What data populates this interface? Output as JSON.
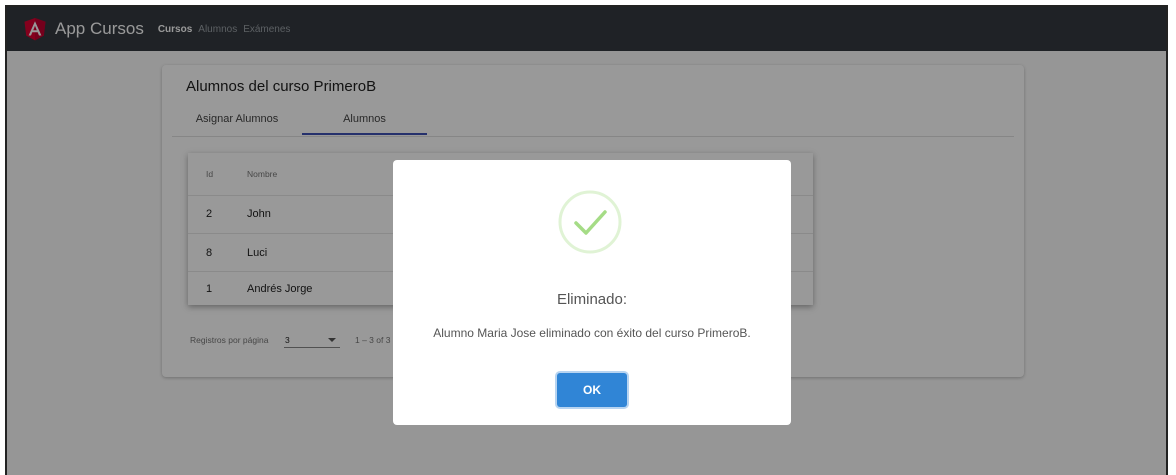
{
  "navbar": {
    "brand": "App Cursos",
    "links": [
      "Cursos",
      "Alumnos",
      "Exámenes"
    ]
  },
  "card": {
    "title": "Alumnos del curso PrimeroB",
    "tabs": [
      "Asignar Alumnos",
      "Alumnos"
    ]
  },
  "table": {
    "headers": [
      "Id",
      "Nombre"
    ],
    "rows": [
      {
        "id": "2",
        "nombre": "John"
      },
      {
        "id": "8",
        "nombre": "Luci"
      },
      {
        "id": "1",
        "nombre": "Andrés Jorge"
      }
    ]
  },
  "paginator": {
    "label": "Registros por página",
    "page_size": "3",
    "range": "1 – 3 of 3"
  },
  "dialog": {
    "title": "Eliminado:",
    "message": "Alumno Maria Jose eliminado con éxito del curso PrimeroB.",
    "ok_label": "OK",
    "icon": "check-icon"
  },
  "colors": {
    "navbar": "#343a40",
    "angular_red": "#dd0031",
    "tab_ink": "#3f51b5",
    "success": "#a5dc86",
    "ok_button": "#3085d6"
  }
}
